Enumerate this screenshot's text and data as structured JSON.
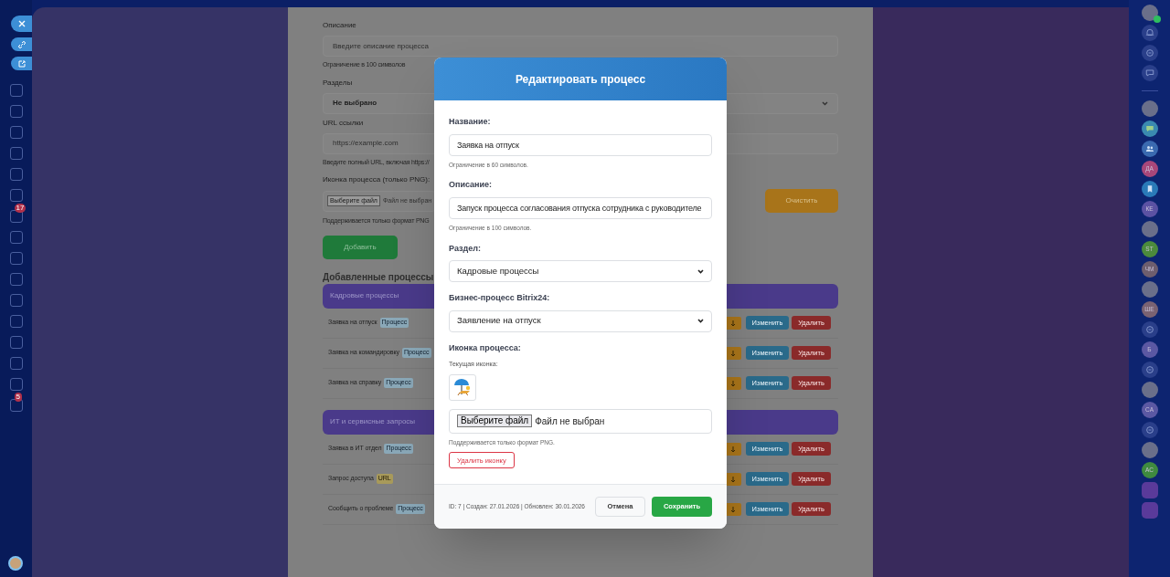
{
  "sidebar": {
    "items": [
      {
        "kind": "icon"
      },
      {
        "kind": "icon"
      },
      {
        "kind": "icon"
      },
      {
        "kind": "icon"
      },
      {
        "kind": "icon"
      },
      {
        "kind": "icon"
      },
      {
        "kind": "icon",
        "badge": "17"
      },
      {
        "kind": "icon"
      },
      {
        "kind": "icon"
      },
      {
        "kind": "icon"
      },
      {
        "kind": "icon"
      },
      {
        "kind": "icon"
      },
      {
        "kind": "icon"
      },
      {
        "kind": "icon"
      },
      {
        "kind": "icon"
      },
      {
        "kind": "icon",
        "badge": "5"
      }
    ]
  },
  "page": {
    "fields": [
      {
        "kind": "input",
        "label": "Описание",
        "placeholder": "Введите описание процесса",
        "hint": "Ограничение в 100 символов"
      },
      {
        "kind": "select",
        "label": "Разделы",
        "value": "Не выбрано"
      },
      {
        "kind": "input",
        "label": "URL ссылки",
        "placeholder": "https://example.com",
        "hint": "Введите полный URL, включая https://"
      },
      {
        "kind": "file",
        "label": "Иконка процесса (только PNG):",
        "file_button": "Выберите файл",
        "file_status": "Файл не выбран",
        "clear_button": "Очистить",
        "hint": "Поддерживается только формат PNG"
      }
    ],
    "add_button": "Добавить",
    "section_title": "Добавленные процессы",
    "groups": [
      {
        "title": "Кадровые процессы",
        "rows": [
          {
            "name": "Заявка на отпуск",
            "badge": {
              "kind": "process",
              "text": "Процесс"
            },
            "edit_button": "Изменить",
            "delete_button": "Удалить"
          },
          {
            "name": "Заявка на командировку",
            "badge": {
              "kind": "process",
              "text": "Процесс"
            },
            "edit_button": "Изменить",
            "delete_button": "Удалить"
          },
          {
            "name": "Заявка на справку",
            "badge": {
              "kind": "process",
              "text": "Процесс"
            },
            "edit_button": "Изменить",
            "delete_button": "Удалить"
          }
        ]
      },
      {
        "title": "ИТ и сервисные запросы",
        "rows": [
          {
            "name": "Заявка в ИТ отдел",
            "badge": {
              "kind": "process",
              "text": "Процесс"
            },
            "edit_button": "Изменить",
            "delete_button": "Удалить"
          },
          {
            "name": "Запрос доступа",
            "badge": {
              "kind": "url",
              "text": "URL"
            },
            "edit_button": "Изменить",
            "delete_button": "Удалить"
          },
          {
            "name": "Сообщить о проблеме",
            "badge": {
              "kind": "process",
              "text": "Процесс"
            },
            "edit_button": "Изменить",
            "delete_button": "Удалить"
          }
        ]
      }
    ]
  },
  "rail": {
    "items": [
      {
        "kind": "photo",
        "online": true
      },
      {
        "kind": "bell"
      },
      {
        "kind": "copilot"
      },
      {
        "kind": "chat"
      },
      {
        "kind": "separator"
      },
      {
        "kind": "photo"
      },
      {
        "kind": "bubble"
      },
      {
        "kind": "group"
      },
      {
        "kind": "initials",
        "text": "ДА",
        "color": "#a8477a"
      },
      {
        "kind": "bookmark"
      },
      {
        "kind": "initials",
        "text": "КЕ",
        "color": "#5b52a3"
      },
      {
        "kind": "photo"
      },
      {
        "kind": "initials",
        "text": "ST",
        "color": "#4c8a3c"
      },
      {
        "kind": "initials",
        "text": "ЧМ",
        "color": "#6e5e6e"
      },
      {
        "kind": "photo"
      },
      {
        "kind": "initials",
        "text": "ШЕ",
        "color": "#7a6272"
      },
      {
        "kind": "copilot"
      },
      {
        "kind": "initials",
        "text": "Б",
        "color": "#5b58a3"
      },
      {
        "kind": "copilot"
      },
      {
        "kind": "photo"
      },
      {
        "kind": "initials",
        "text": "CA",
        "color": "#5b58a3"
      },
      {
        "kind": "copilot"
      },
      {
        "kind": "photo"
      },
      {
        "kind": "initials",
        "text": "AC",
        "color": "#3f8a3f"
      },
      {
        "kind": "tile"
      },
      {
        "kind": "tile"
      }
    ]
  },
  "modal": {
    "title": "Редактировать процесс",
    "fields": [
      {
        "kind": "text",
        "label": "Название:",
        "value": "Заявка на отпуск",
        "hint": "Ограничение в 60 символов."
      },
      {
        "kind": "text",
        "label": "Описание:",
        "value": "Запуск процесса согласования отпуска сотрудника с руководителе",
        "hint": "Ограничение в 100 символов."
      },
      {
        "kind": "select",
        "label": "Раздел:",
        "value": "Кадровые процессы"
      },
      {
        "kind": "select",
        "label": "Бизнес-процесс Bitrix24:",
        "value": "Заявление на отпуск"
      },
      {
        "kind": "icon",
        "label": "Иконка процесса:",
        "current_label": "Текущая иконка:",
        "file_button": "Выберите файл",
        "file_status": "Файл не выбран",
        "hint": "Поддерживается только формат PNG.",
        "remove_button": "Удалить иконку"
      }
    ],
    "meta": "ID: 7 | Создан: 27.01.2026 | Обновлен: 30.01.2026",
    "cancel_button": "Отмена",
    "save_button": "Сохранить"
  }
}
